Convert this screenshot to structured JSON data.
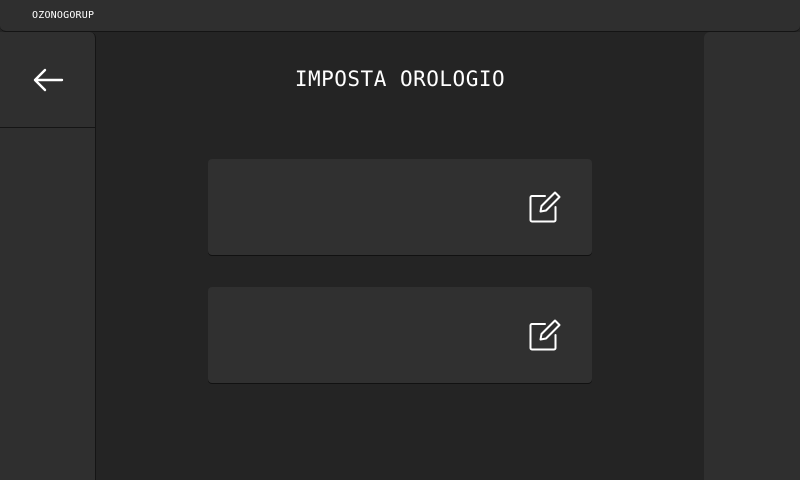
{
  "topbar": {
    "brand": "OZONOGORUP"
  },
  "nav": {
    "back_icon": "arrow-left-icon"
  },
  "page": {
    "title": "IMPOSTA OROLOGIO"
  },
  "cards": [
    {
      "icon": "edit-icon"
    },
    {
      "icon": "edit-icon"
    }
  ],
  "colors": {
    "background": "#242424",
    "panel": "#2f2f2f",
    "card": "#303030",
    "text": "#ffffff"
  }
}
